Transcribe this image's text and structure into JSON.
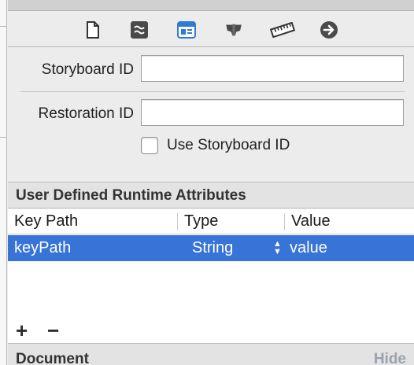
{
  "inspector_tabs": [
    {
      "name": "file-inspector",
      "icon": "document-icon"
    },
    {
      "name": "quick-help",
      "icon": "quick-help-icon"
    },
    {
      "name": "identity-inspector",
      "icon": "identity-icon",
      "active": true
    },
    {
      "name": "attributes-inspector",
      "icon": "attributes-icon"
    },
    {
      "name": "size-inspector",
      "icon": "ruler-icon"
    },
    {
      "name": "connections-inspector",
      "icon": "arrow-circle-icon"
    }
  ],
  "identity": {
    "storyboard_id_label": "Storyboard ID",
    "storyboard_id_value": "",
    "restoration_id_label": "Restoration ID",
    "restoration_id_value": "",
    "use_storyboard_id_label": "Use Storyboard ID",
    "use_storyboard_id_checked": false
  },
  "runtime_attributes": {
    "title": "User Defined Runtime Attributes",
    "columns": [
      "Key Path",
      "Type",
      "Value"
    ],
    "rows": [
      {
        "key_path": "keyPath",
        "type": "String",
        "value": "value",
        "selected": true
      }
    ],
    "add_label": "+",
    "remove_label": "−"
  },
  "document_section": {
    "title": "Document",
    "hide_label": "Hide"
  },
  "colors": {
    "selection": "#3874d7",
    "active_tab": "#2f7bd6",
    "panel_bg": "#ececec"
  }
}
